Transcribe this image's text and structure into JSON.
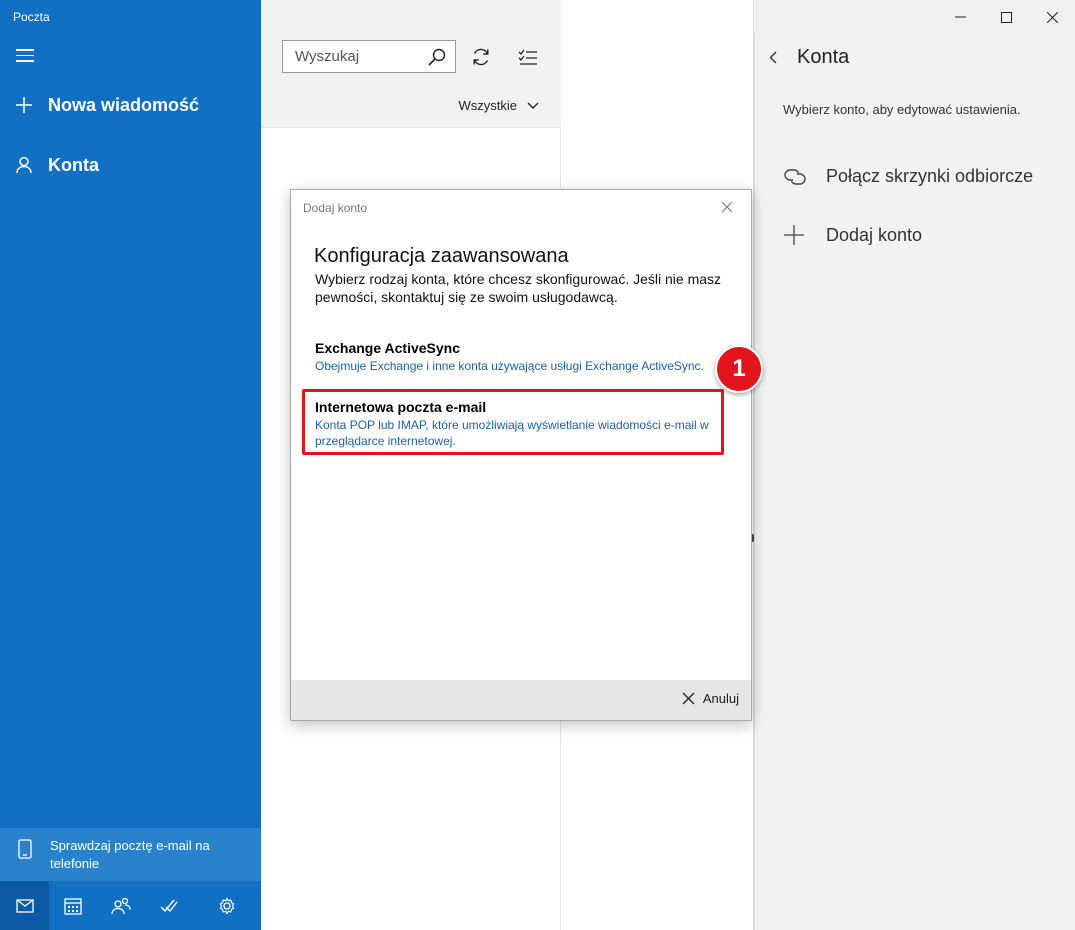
{
  "app": {
    "title": "Poczta"
  },
  "nav": {
    "new_message": "Nowa wiadomość",
    "accounts": "Konta",
    "phone_promo": "Sprawdzaj pocztę e-mail na telefonie",
    "bottom_icons": [
      "mail-icon",
      "calendar-icon",
      "people-icon",
      "todo-icon",
      "settings-icon"
    ]
  },
  "list": {
    "search_placeholder": "Wyszukaj",
    "filter": "Wszystkie"
  },
  "flyout": {
    "title": "Konta",
    "description": "Wybierz konto, aby edytować ustawienia.",
    "link_inboxes": "Połącz skrzynki odbiorcze",
    "add_account": "Dodaj konto"
  },
  "dialog": {
    "title": "Dodaj konto",
    "heading": "Konfiguracja zaawansowana",
    "subtitle": "Wybierz rodzaj konta, które chcesz skonfigurować. Jeśli nie masz pewności, skontaktuj się ze swoim usługodawcą.",
    "options": [
      {
        "title": "Exchange ActiveSync",
        "description": "Obejmuje Exchange i inne konta używające usługi Exchange ActiveSync."
      },
      {
        "title": "Internetowa poczta e-mail",
        "description": "Konta POP lub IMAP, które umożliwiają wyświetlanie wiadomości e-mail w przeglądarce internetowej."
      }
    ],
    "cancel": "Anuluj"
  },
  "annotation": {
    "step": "1"
  },
  "colors": {
    "nav_blue": "#1170c4",
    "highlight_red": "#e4141d",
    "link_blue": "#1a5fb4"
  }
}
